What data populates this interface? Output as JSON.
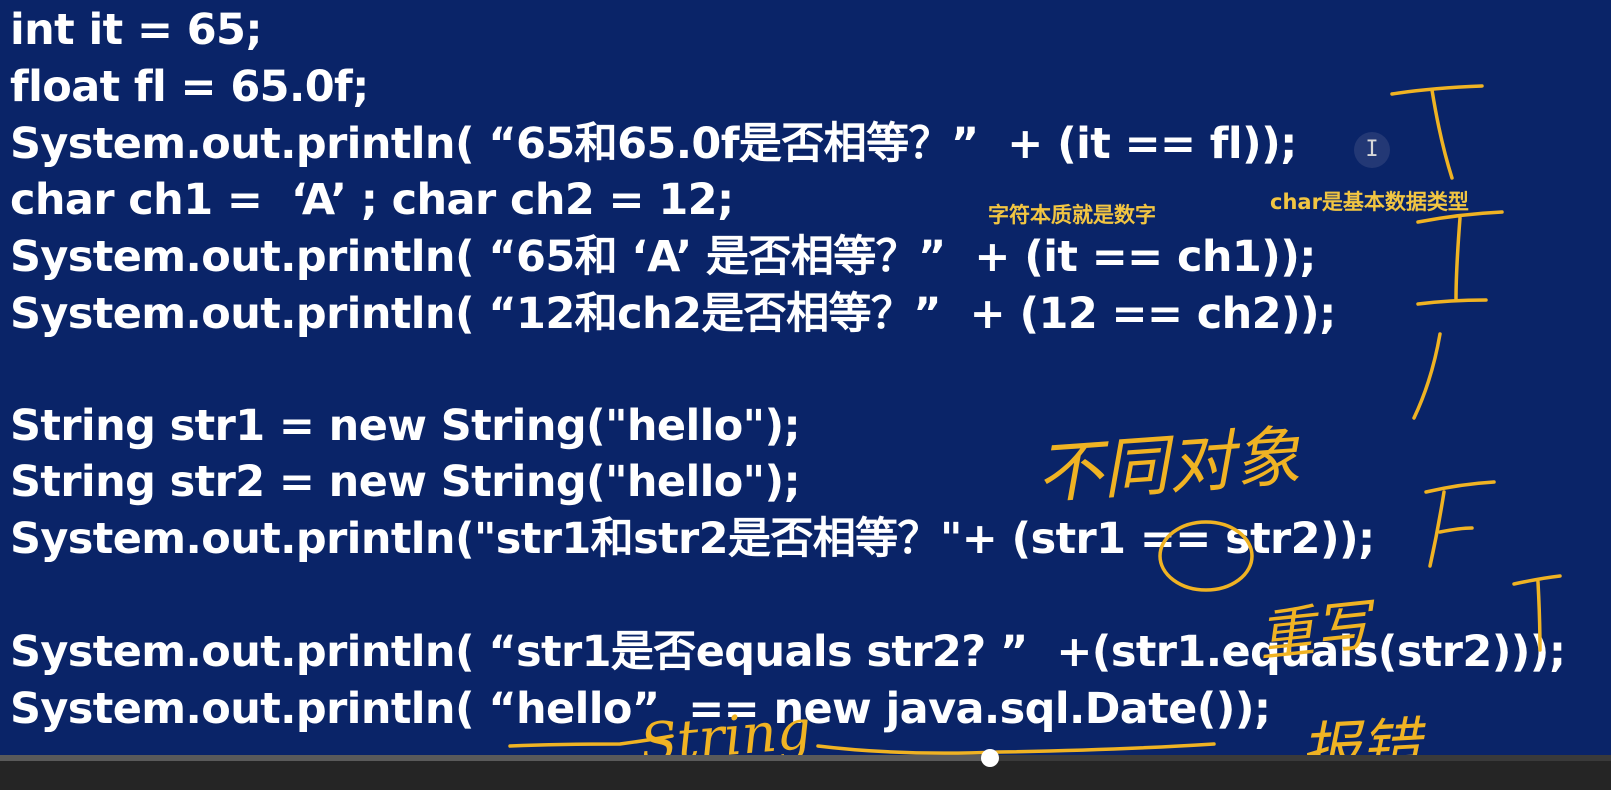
{
  "code_lines": [
    "int it = 65;",
    "float fl = 65.0f;",
    "System.out.println( “65和65.0f是否相等？”  + (it == fl));",
    "char ch1 =  ‘A’ ; char ch2 = 12;",
    "System.out.println( “65和 ‘A’ 是否相等？”  + (it == ch1));",
    "System.out.println( “12和ch2是否相等？”  + (12 == ch2));",
    "String str1 = new String(\"hello\");",
    "String str2 = new String(\"hello\");",
    "System.out.println(\"str1和str2是否相等？\"+ (str1 == str2));",
    "System.out.println( “str1是否equals str2? ”  +(str1.equals(str2)));",
    "System.out.println( “hello”  == new java.sql.Date());"
  ],
  "annotations": {
    "char_numeric": "字符本质就是数字",
    "char_primitive": "char是基本数据类型",
    "different_objects": "不同对象",
    "overridden": "重写",
    "string_word": "String",
    "compile_error": "报错"
  },
  "video": {
    "progress": 0.6143
  },
  "colors": {
    "background": "#0a2468",
    "code_text": "#ffffff",
    "annotation": "#f0b323"
  }
}
